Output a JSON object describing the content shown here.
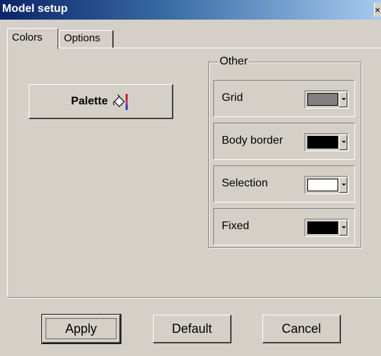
{
  "window": {
    "title": "Model setup",
    "close_label": "×"
  },
  "tabs": [
    {
      "label": "Colors",
      "active": true
    },
    {
      "label": "Options",
      "active": false
    }
  ],
  "palette_button": {
    "label": "Palette",
    "icon": "paint-bucket-icon"
  },
  "other_group": {
    "legend": "Other",
    "rows": [
      {
        "label": "Grid",
        "color": "#808080"
      },
      {
        "label": "Body border",
        "color": "#000000"
      },
      {
        "label": "Selection",
        "color": "#ffffff"
      },
      {
        "label": "Fixed",
        "color": "#000000"
      }
    ]
  },
  "buttons": {
    "apply": "Apply",
    "default": "Default",
    "cancel": "Cancel"
  }
}
